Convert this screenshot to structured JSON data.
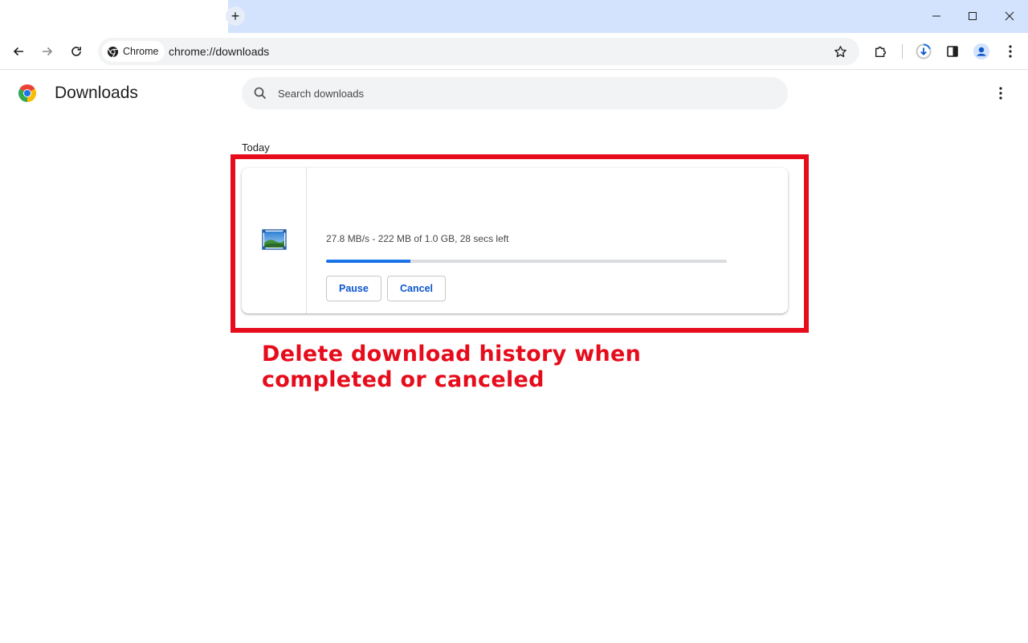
{
  "browser": {
    "new_tab_symbol": "+",
    "omnibox": {
      "chip_label": "Chrome",
      "url": "chrome://downloads"
    }
  },
  "page": {
    "title": "Downloads",
    "search": {
      "placeholder": "Search downloads",
      "value": ""
    }
  },
  "downloads": {
    "date_group": "Today",
    "item": {
      "status": "27.8 MB/s - 222 MB of 1.0 GB, 28 secs left",
      "progress_fraction": 0.21,
      "pause_label": "Pause",
      "cancel_label": "Cancel"
    }
  },
  "annotation": {
    "text": "Delete download history when completed or canceled"
  },
  "colors": {
    "accent": "#1a73e8",
    "tabstrip": "#d3e3fd",
    "annotation_red": "#e60c1c"
  }
}
